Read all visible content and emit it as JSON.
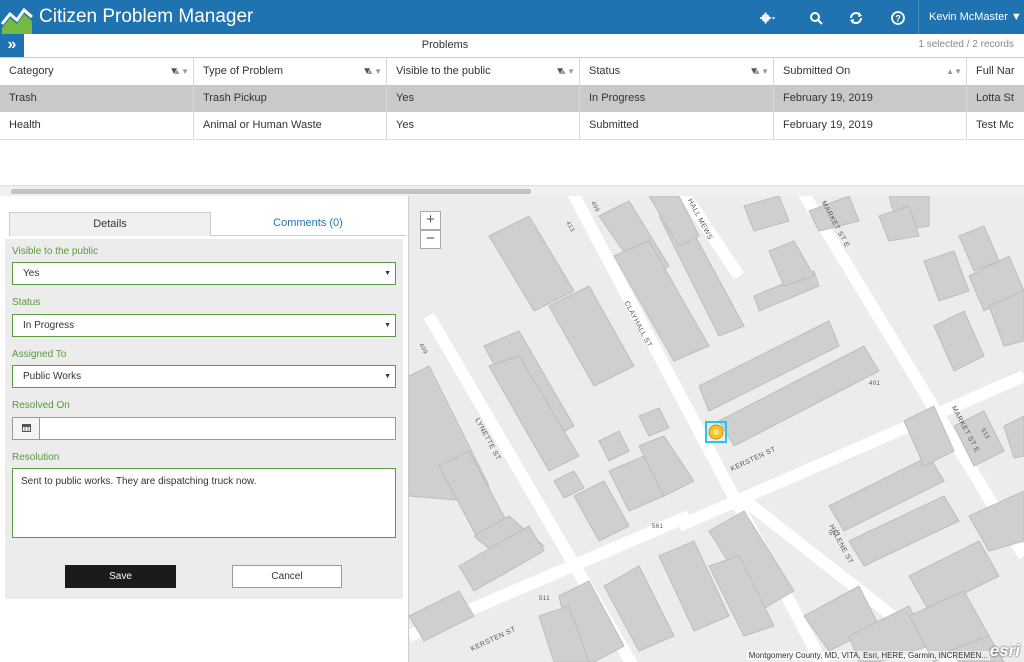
{
  "app": {
    "title": "Citizen Problem Manager",
    "user": "Kevin McMaster ▼"
  },
  "header_icons": [
    "gear-icon",
    "search-icon",
    "refresh-icon",
    "help-icon"
  ],
  "problems": {
    "title": "Problems",
    "record_count": "1 selected / 2 records"
  },
  "table": {
    "columns": [
      "Category",
      "Type of Problem",
      "Visible to the public",
      "Status",
      "Submitted On",
      "Full Nar"
    ],
    "rows": [
      {
        "category": "Trash",
        "type": "Trash Pickup",
        "visible": "Yes",
        "status": "In Progress",
        "submitted": "February 19, 2019",
        "full_name": "Lotta St",
        "selected": true
      },
      {
        "category": "Health",
        "type": "Animal or Human Waste",
        "visible": "Yes",
        "status": "Submitted",
        "submitted": "February 19, 2019",
        "full_name": "Test Mc",
        "selected": false
      }
    ]
  },
  "tabs": {
    "details": "Details",
    "comments": "Comments (0)"
  },
  "form": {
    "visible_label": "Visible to the public",
    "visible_value": "Yes",
    "status_label": "Status",
    "status_value": "In Progress",
    "assigned_label": "Assigned To",
    "assigned_value": "Public Works",
    "resolved_label": "Resolved On",
    "resolved_value": "",
    "resolution_label": "Resolution",
    "resolution_value": "Sent to public works. They are dispatching truck now.",
    "save_label": "Save",
    "cancel_label": "Cancel"
  },
  "map": {
    "zoom_in": "+",
    "zoom_out": "−",
    "attribution": "Montgomery County, MD, VITA, Esri, HERE, Garmin, INCREMEN...",
    "logo": "esri",
    "streets": [
      "CLAYHALL ST",
      "LYNETTE ST",
      "KERSTEN ST",
      "HELENE ST",
      "MARKET ST E",
      "MARKET ST E",
      "HALL MEWS",
      "KERSTEN ST"
    ],
    "address_numbers": [
      "413",
      "409",
      "409",
      "401",
      "561",
      "511",
      "513",
      "515"
    ]
  },
  "colors": {
    "header": "#1f73b0",
    "accent_green": "#5b9a40",
    "selected_row": "#c9c9c9",
    "marker": "#f2c230"
  }
}
